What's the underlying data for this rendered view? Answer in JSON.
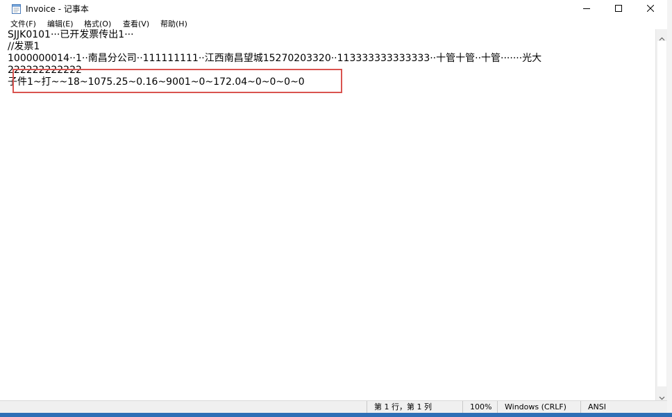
{
  "window": {
    "title": "Invoice - 记事本"
  },
  "menu": {
    "file": "文件(F)",
    "edit": "编辑(E)",
    "format": "格式(O)",
    "view": "查看(V)",
    "help": "帮助(H)"
  },
  "editor": {
    "lines": [
      "SJJK0101···已开发票传出1···",
      "//发票1",
      "1000000014··1··南昌分公司··111111111··江西南昌望城15270203320··113333333333333··十管十管··十管·······光大",
      "222222222222",
      "子件1~打~~18~1075.25~0.16~9001~0~172.04~0~0~0~0"
    ]
  },
  "status": {
    "position": "第 1 行，第 1 列",
    "zoom": "100%",
    "line_ending": "Windows (CRLF)",
    "encoding": "ANSI"
  },
  "colors": {
    "highlight": "#d9534f",
    "bottom_edge": "#2f6fb6"
  },
  "icons": {
    "app": "notepad-icon",
    "minimize": "minimize-icon",
    "maximize": "maximize-icon",
    "close": "close-icon"
  }
}
